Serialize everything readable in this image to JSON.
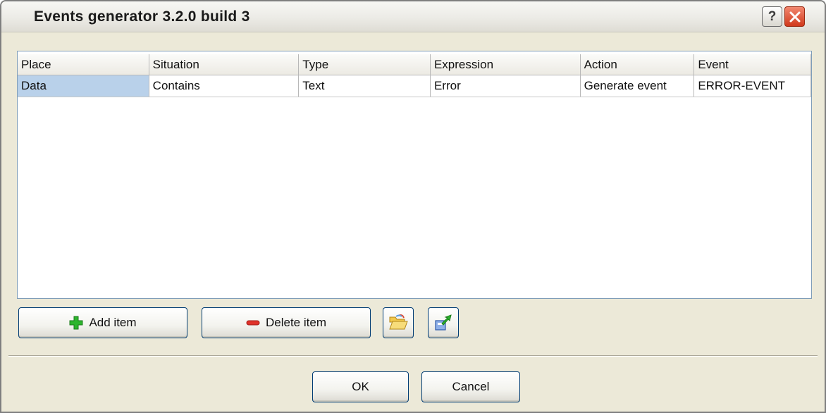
{
  "window": {
    "title": "Events generator 3.2.0 build 3",
    "help_label": "?"
  },
  "grid": {
    "columns": [
      "Place",
      "Situation",
      "Type",
      "Expression",
      "Action",
      "Event"
    ],
    "rows": [
      [
        "Data",
        "Contains",
        "Text",
        "Error",
        "Generate event",
        "ERROR-EVENT"
      ]
    ]
  },
  "toolbar": {
    "add_label": "Add item",
    "delete_label": "Delete item",
    "open_icon": "folder-open-icon",
    "export_icon": "export-icon"
  },
  "footer": {
    "ok_label": "OK",
    "cancel_label": "Cancel"
  },
  "colors": {
    "selection": "#b9d1ea",
    "add_icon": "#2db52d",
    "delete_icon": "#e0322a"
  }
}
